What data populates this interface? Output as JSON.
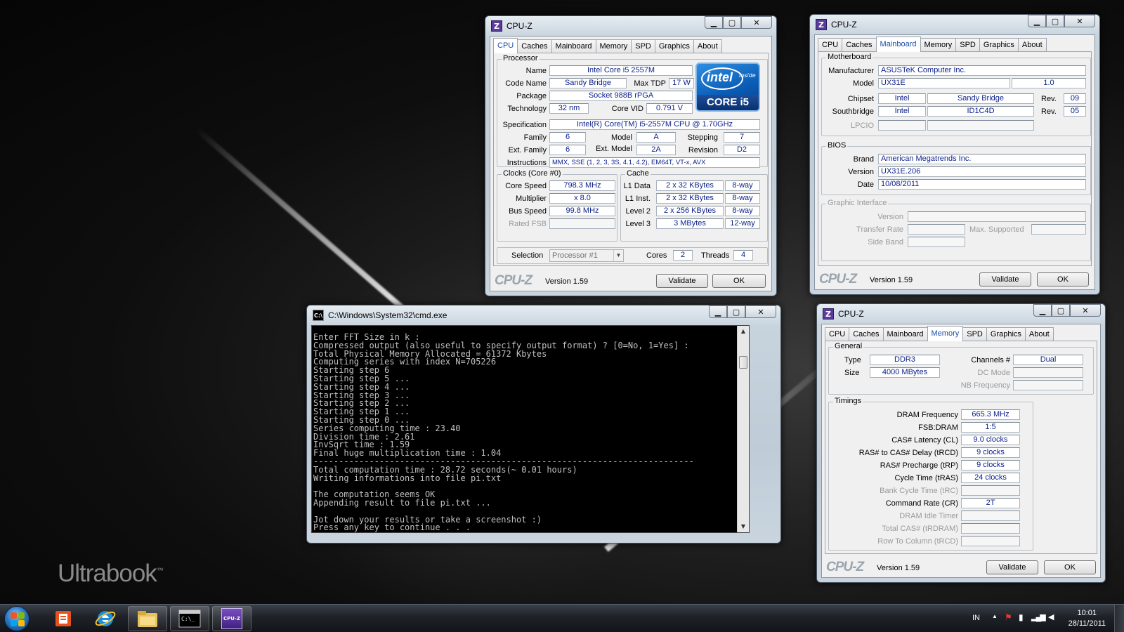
{
  "desktop": {
    "brand_text": "Ultrabook",
    "brand_tm": "™"
  },
  "cpuz_cpu": {
    "title": "CPU-Z",
    "tabs": [
      "CPU",
      "Caches",
      "Mainboard",
      "Memory",
      "SPD",
      "Graphics",
      "About"
    ],
    "active_tab": "CPU",
    "processor": {
      "legend": "Processor",
      "name_label": "Name",
      "name": "Intel Core i5 2557M",
      "codename_label": "Code Name",
      "codename": "Sandy Bridge",
      "maxtdp_label": "Max TDP",
      "maxtdp": "17 W",
      "package_label": "Package",
      "package": "Socket 988B rPGA",
      "technology_label": "Technology",
      "technology": "32 nm",
      "corevid_label": "Core VID",
      "corevid": "0.791 V",
      "spec_label": "Specification",
      "spec": "Intel(R) Core(TM) i5-2557M CPU @ 1.70GHz",
      "family_label": "Family",
      "family": "6",
      "model_label": "Model",
      "model": "A",
      "stepping_label": "Stepping",
      "stepping": "7",
      "extfamily_label": "Ext. Family",
      "extfamily": "6",
      "extmodel_label": "Ext. Model",
      "extmodel": "2A",
      "revision_label": "Revision",
      "revision": "D2",
      "instructions_label": "Instructions",
      "instructions": "MMX, SSE (1, 2, 3, 3S, 4.1, 4.2), EM64T, VT-x, AVX"
    },
    "intel_badge": {
      "logo": "intel",
      "inside": "inside",
      "core": "CORE i5"
    },
    "clocks": {
      "legend": "Clocks (Core #0)",
      "corespeed_label": "Core Speed",
      "corespeed": "798.3 MHz",
      "multiplier_label": "Multiplier",
      "multiplier": "x 8.0",
      "busspeed_label": "Bus Speed",
      "busspeed": "99.8 MHz",
      "ratedfsb_label": "Rated FSB",
      "ratedfsb": ""
    },
    "cache": {
      "legend": "Cache",
      "l1d_label": "L1 Data",
      "l1d": "2 x 32 KBytes",
      "l1d_way": "8-way",
      "l1i_label": "L1 Inst.",
      "l1i": "2 x 32 KBytes",
      "l1i_way": "8-way",
      "l2_label": "Level 2",
      "l2": "2 x 256 KBytes",
      "l2_way": "8-way",
      "l3_label": "Level 3",
      "l3": "3 MBytes",
      "l3_way": "12-way"
    },
    "selection_label": "Selection",
    "selection": "Processor #1",
    "cores_label": "Cores",
    "cores": "2",
    "threads_label": "Threads",
    "threads": "4",
    "footer": {
      "brand": "CPU-Z",
      "version": "Version 1.59",
      "validate": "Validate",
      "ok": "OK"
    }
  },
  "cpuz_mb": {
    "title": "CPU-Z",
    "tabs": [
      "CPU",
      "Caches",
      "Mainboard",
      "Memory",
      "SPD",
      "Graphics",
      "About"
    ],
    "active_tab": "Mainboard",
    "motherboard": {
      "legend": "Motherboard",
      "manufacturer_label": "Manufacturer",
      "manufacturer": "ASUSTeK Computer Inc.",
      "model_label": "Model",
      "model": "UX31E",
      "model_rev": "1.0",
      "chipset_label": "Chipset",
      "chipset_vendor": "Intel",
      "chipset_name": "Sandy Bridge",
      "chipset_rev_label": "Rev.",
      "chipset_rev": "09",
      "southbridge_label": "Southbridge",
      "sb_vendor": "Intel",
      "sb_name": "ID1C4D",
      "sb_rev_label": "Rev.",
      "sb_rev": "05",
      "lpcio_label": "LPCIO"
    },
    "bios": {
      "legend": "BIOS",
      "brand_label": "Brand",
      "brand": "American Megatrends Inc.",
      "version_label": "Version",
      "version": "UX31E.206",
      "date_label": "Date",
      "date": "10/08/2011"
    },
    "graphic": {
      "legend": "Graphic Interface",
      "version_label": "Version",
      "transfer_label": "Transfer Rate",
      "maxsup_label": "Max. Supported",
      "sideband_label": "Side Band"
    },
    "footer": {
      "brand": "CPU-Z",
      "version": "Version 1.59",
      "validate": "Validate",
      "ok": "OK"
    }
  },
  "cpuz_mem": {
    "title": "CPU-Z",
    "tabs": [
      "CPU",
      "Caches",
      "Mainboard",
      "Memory",
      "SPD",
      "Graphics",
      "About"
    ],
    "active_tab": "Memory",
    "general": {
      "legend": "General",
      "type_label": "Type",
      "type": "DDR3",
      "size_label": "Size",
      "size": "4000 MBytes",
      "channels_label": "Channels #",
      "channels": "Dual",
      "dcmode_label": "DC Mode",
      "nbfreq_label": "NB Frequency"
    },
    "timings": {
      "legend": "Timings",
      "rows": [
        {
          "label": "DRAM Frequency",
          "value": "665.3 MHz",
          "disabled": false
        },
        {
          "label": "FSB:DRAM",
          "value": "1:5",
          "disabled": false
        },
        {
          "label": "CAS# Latency (CL)",
          "value": "9.0 clocks",
          "disabled": false
        },
        {
          "label": "RAS# to CAS# Delay (tRCD)",
          "value": "9 clocks",
          "disabled": false
        },
        {
          "label": "RAS# Precharge (tRP)",
          "value": "9 clocks",
          "disabled": false
        },
        {
          "label": "Cycle Time (tRAS)",
          "value": "24 clocks",
          "disabled": false
        },
        {
          "label": "Bank Cycle Time (tRC)",
          "value": "",
          "disabled": true
        },
        {
          "label": "Command Rate (CR)",
          "value": "2T",
          "disabled": false
        },
        {
          "label": "DRAM Idle Timer",
          "value": "",
          "disabled": true
        },
        {
          "label": "Total CAS# (tRDRAM)",
          "value": "",
          "disabled": true
        },
        {
          "label": "Row To Column (tRCD)",
          "value": "",
          "disabled": true
        }
      ]
    },
    "footer": {
      "brand": "CPU-Z",
      "version": "Version 1.59",
      "validate": "Validate",
      "ok": "OK"
    }
  },
  "cmd": {
    "title": "C:\\Windows\\System32\\cmd.exe",
    "output": "Enter FFT Size in k :\nCompressed output (also useful to specify output format) ? [0=No, 1=Yes] :\nTotal Physical Memory Allocated = 61372 Kbytes\nComputing series with index N=705226\nStarting step 6\nStarting step 5 ...\nStarting step 4 ...\nStarting step 3 ...\nStarting step 2 ...\nStarting step 1 ...\nStarting step 0 ...\nSeries computing time : 23.40\nDivision time : 2.61\nInvSqrt time : 1.59\nFinal huge multiplication time : 1.04\n---------------------------------------------------------------------------\nTotal computation time : 28.72 seconds(~ 0.01 hours)\nWriting informations into file pi.txt\n\nThe computation seems OK\nAppending result to file pi.txt ...\n\nJot down your results or take a screenshot :)\nPress any key to continue . . ."
  },
  "taskbar": {
    "lang": "IN",
    "time": "10:01",
    "date": "28/11/2011",
    "pinned": [
      {
        "name": "office-icon"
      },
      {
        "name": "internet-explorer-icon"
      },
      {
        "name": "explorer-folder-icon"
      },
      {
        "name": "cmd-icon"
      },
      {
        "name": "cpuz-icon"
      }
    ],
    "cpuz_icon_text": "CPU-Z"
  },
  "colors": {
    "field_text": "#0a1f8a",
    "active_tab": "#1a4fa8",
    "console_bg": "#000000",
    "console_text": "#c0c0c0"
  }
}
